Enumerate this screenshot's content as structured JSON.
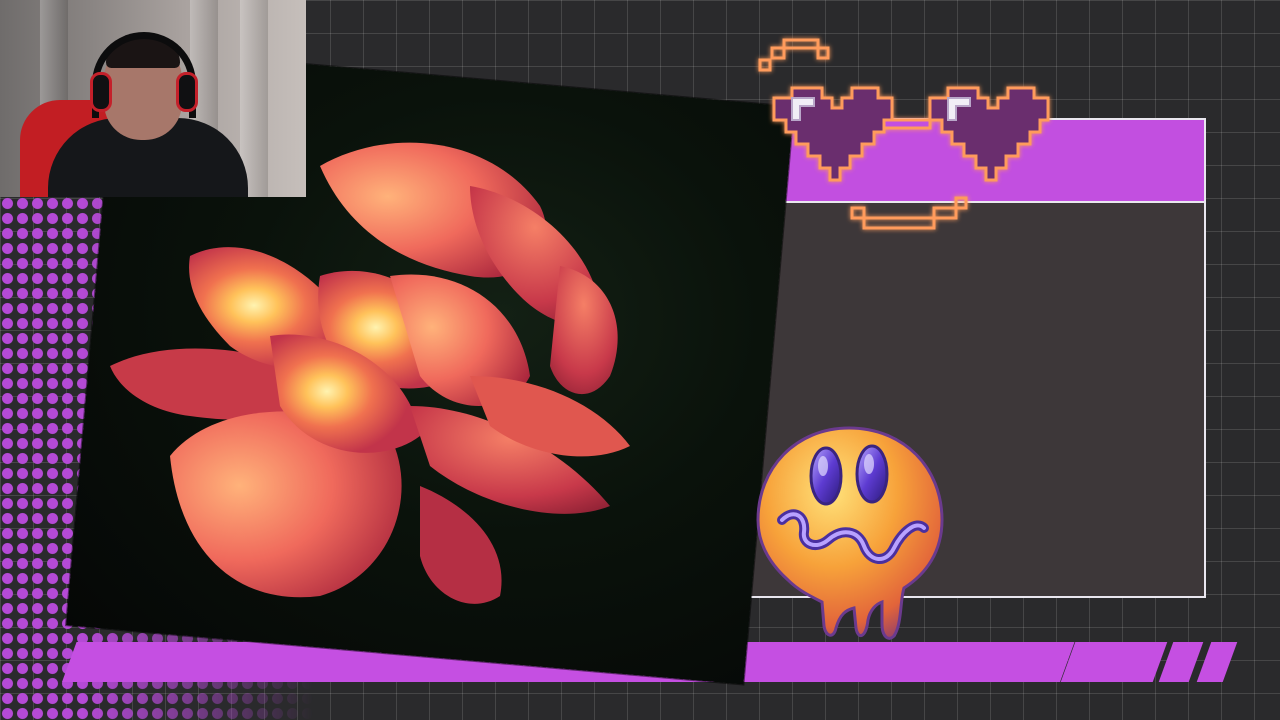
{
  "scene": {
    "background_color": "#2a2a2c",
    "grid_color": "rgba(255,255,255,0.13)",
    "accent_purple": "#c54fe2",
    "panel_fill": "#3d3739",
    "panel_border": "#e9e6ef"
  },
  "webcam": {
    "icon": "person-with-headset"
  },
  "photo": {
    "subject": "rose-flower"
  },
  "decorations": {
    "smiley_icon": "melting-smiley-icon",
    "hearts_icon": "pixel-hearts-icon"
  }
}
